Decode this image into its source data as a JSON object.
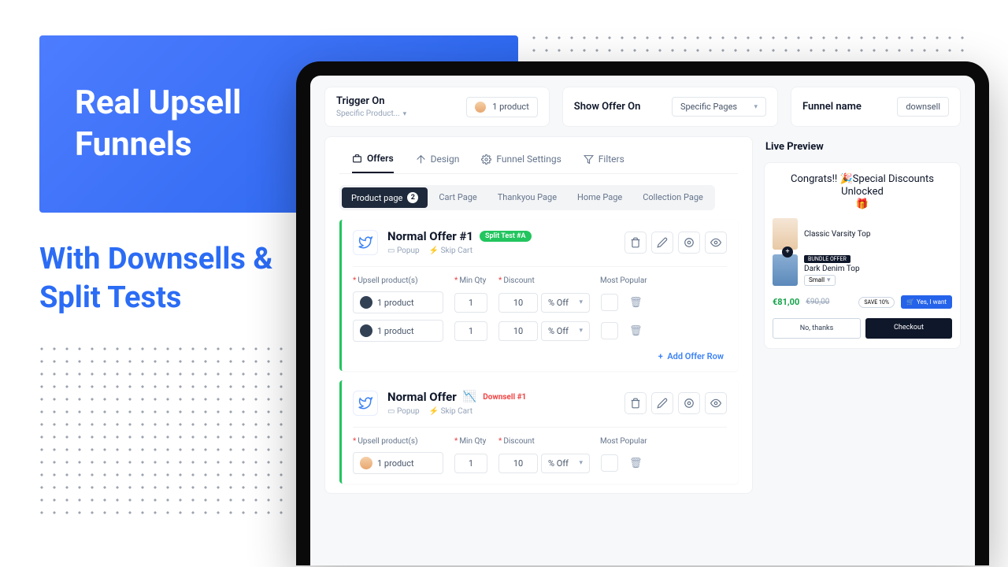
{
  "promo": {
    "title_l1": "Real Upsell",
    "title_l2": "Funnels",
    "sub_l1": "With Downsells &",
    "sub_l2": "Split Tests"
  },
  "top": {
    "trigger_label": "Trigger On",
    "trigger_sub": "Specific Product...",
    "trigger_value": "1 product",
    "show_label": "Show Offer On",
    "show_value": "Specific Pages",
    "name_label": "Funnel name",
    "name_value": "downsell"
  },
  "tabs": {
    "offers": "Offers",
    "design": "Design",
    "settings": "Funnel Settings",
    "filters": "Filters"
  },
  "chips": {
    "product": "Product page",
    "product_count": "2",
    "cart": "Cart Page",
    "thank": "Thankyou Page",
    "home": "Home Page",
    "collection": "Collection Page"
  },
  "headers": {
    "upsell": "Upsell product(s)",
    "minqty": "Min Qty",
    "discount": "Discount",
    "popular": "Most Popular"
  },
  "offer1": {
    "title": "Normal Offer #1",
    "split_badge": "Split Test #A",
    "meta_popup": "Popup",
    "meta_skip": "Skip Cart",
    "rows": [
      {
        "product": "1 product",
        "qty": "1",
        "disc": "10",
        "disc_type": "% Off"
      },
      {
        "product": "1 product",
        "qty": "1",
        "disc": "10",
        "disc_type": "% Off"
      }
    ]
  },
  "add_row": "Add Offer Row",
  "offer2": {
    "title": "Normal Offer",
    "down_badge": "Downsell #1",
    "meta_popup": "Popup",
    "meta_skip": "Skip Cart",
    "rows": [
      {
        "product": "1 product",
        "qty": "1",
        "disc": "10",
        "disc_type": "% Off"
      }
    ]
  },
  "preview": {
    "title": "Live Preview",
    "congrats": "Congrats!! 🎉Special Discounts Unlocked",
    "gift": "🎁",
    "p1": "Classic Varsity Top",
    "bundle": "BUNDLE OFFER",
    "p2": "Dark Denim Top",
    "size": "Small",
    "price": "€81,00",
    "old": "€90,00",
    "save": "SAVE 10%",
    "cta": "Yes, I want",
    "no": "No, thanks",
    "checkout": "Checkout"
  }
}
